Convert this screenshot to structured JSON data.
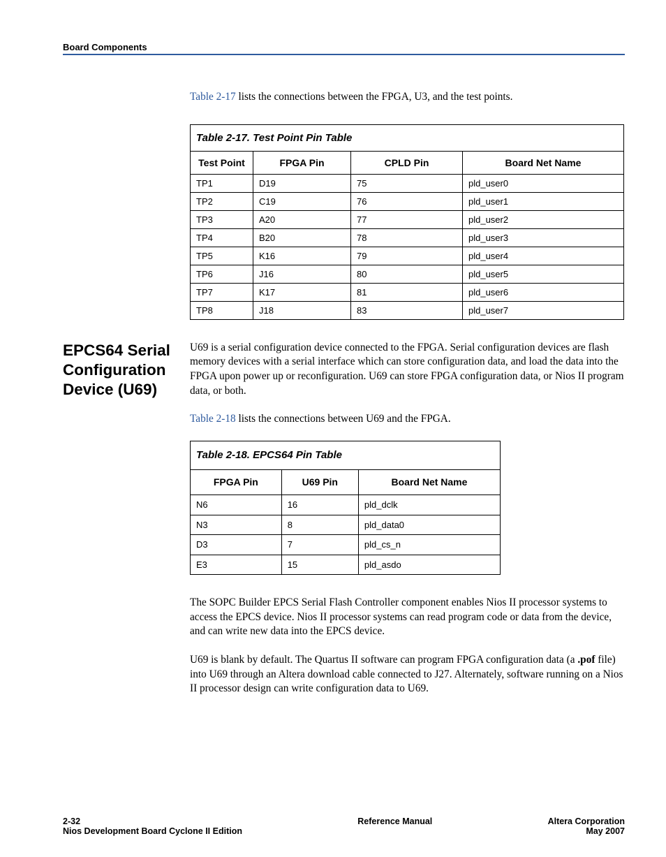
{
  "header": {
    "section": "Board Components"
  },
  "intro17": {
    "prefix": "Table 2-17",
    "rest": " lists the connections between the FPGA, U3, and the test points."
  },
  "table17": {
    "title": "Table 2-17. Test Point Pin Table",
    "headers": {
      "c1": "Test Point",
      "c2": "FPGA Pin",
      "c3": "CPLD Pin",
      "c4": "Board Net Name"
    },
    "rows": [
      {
        "c1": "TP1",
        "c2": "D19",
        "c3": "75",
        "c4": "pld_user0"
      },
      {
        "c1": "TP2",
        "c2": "C19",
        "c3": "76",
        "c4": "pld_user1"
      },
      {
        "c1": "TP3",
        "c2": "A20",
        "c3": "77",
        "c4": "pld_user2"
      },
      {
        "c1": "TP4",
        "c2": "B20",
        "c3": "78",
        "c4": "pld_user3"
      },
      {
        "c1": "TP5",
        "c2": "K16",
        "c3": "79",
        "c4": "pld_user4"
      },
      {
        "c1": "TP6",
        "c2": "J16",
        "c3": "80",
        "c4": "pld_user5"
      },
      {
        "c1": "TP7",
        "c2": "K17",
        "c3": "81",
        "c4": "pld_user6"
      },
      {
        "c1": "TP8",
        "c2": "J18",
        "c3": "83",
        "c4": "pld_user7"
      }
    ]
  },
  "sectionHeading": "EPCS64 Serial Configuration Device (U69)",
  "para1": "U69 is a serial configuration device connected to the FPGA. Serial configuration devices are flash memory devices with a serial interface which can store configuration data, and load the data into the FPGA upon power up or reconfiguration. U69 can store FPGA configuration data, or Nios II program data, or both.",
  "intro18": {
    "prefix": "Table 2-18",
    "rest": " lists the connections between U69 and the FPGA."
  },
  "table18": {
    "title": "Table 2-18. EPCS64 Pin Table",
    "headers": {
      "c1": "FPGA Pin",
      "c2": "U69 Pin",
      "c3": "Board Net Name"
    },
    "rows": [
      {
        "c1": "N6",
        "c2": "16",
        "c3": "pld_dclk"
      },
      {
        "c1": "N3",
        "c2": "8",
        "c3": "pld_data0"
      },
      {
        "c1": "D3",
        "c2": "7",
        "c3": "pld_cs_n"
      },
      {
        "c1": "E3",
        "c2": "15",
        "c3": "pld_asdo"
      }
    ]
  },
  "para2": "The SOPC Builder EPCS Serial Flash Controller component enables Nios II processor systems to access the EPCS device. Nios II processor systems can read program code or data from the device, and can write new data into the EPCS device.",
  "para3a": "U69 is blank by default. The Quartus II software can program FPGA configuration data (a ",
  "para3b": ".pof",
  "para3c": " file) into U69 through an Altera download cable connected to J27. Alternately, software running on a Nios II processor design can write configuration data to U69.",
  "footer": {
    "leftTop": "2-32",
    "leftBottom": "Nios Development Board Cyclone II Edition",
    "center": "Reference Manual",
    "rightTop": "Altera Corporation",
    "rightBottom": "May 2007"
  }
}
